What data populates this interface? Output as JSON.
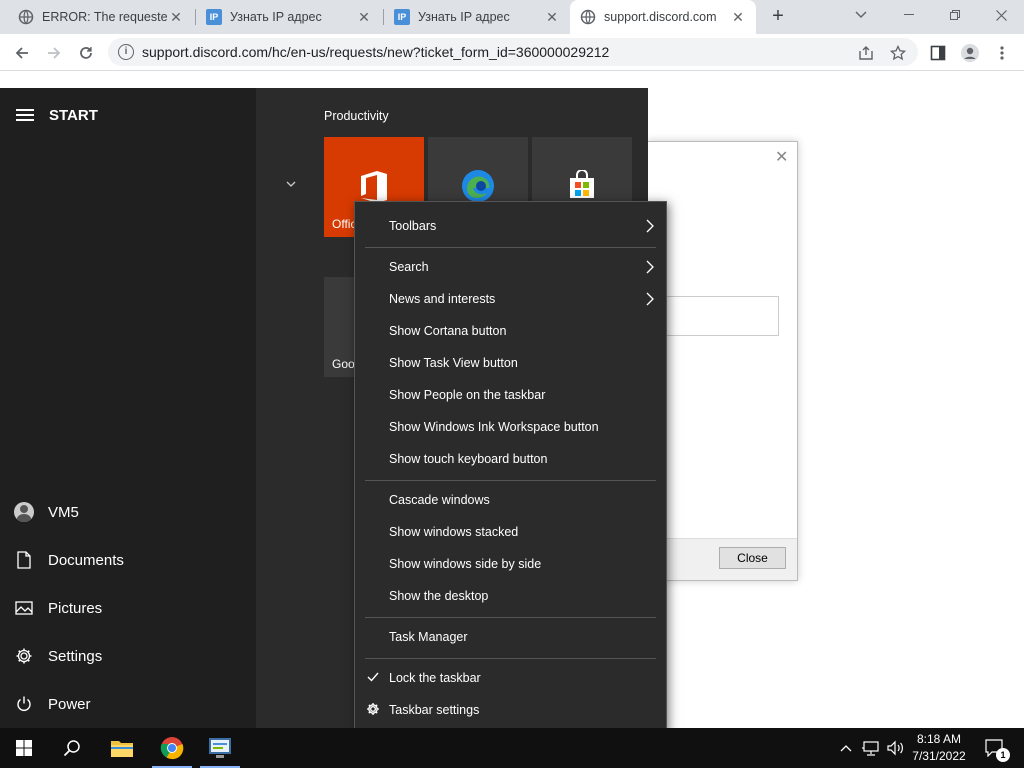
{
  "browser": {
    "tabs": [
      {
        "title": "ERROR: The requested URL could not be retrieved",
        "icon": "globe-icon"
      },
      {
        "title": "Узнать IP адрес",
        "icon": "ip-icon"
      },
      {
        "title": "Узнать IP адрес",
        "icon": "ip-icon"
      },
      {
        "title": "support.discord.com",
        "icon": "globe-icon"
      }
    ],
    "active_tab": 3,
    "url": "support.discord.com/hc/en-us/requests/new?ticket_form_id=360000029212",
    "ip_icon_text": "IP",
    "ip_icon_color": "#4a90d9"
  },
  "dialog": {
    "close_button": "Close"
  },
  "start_menu": {
    "title": "START",
    "user": "VM5",
    "items": [
      "Documents",
      "Pictures",
      "Settings",
      "Power"
    ],
    "group_title": "Productivity",
    "tiles": [
      {
        "label": "Office",
        "color": "#d83b01"
      },
      {
        "label": "",
        "color": "#3a3a3a"
      },
      {
        "label": "",
        "color": "#3a3a3a"
      },
      {
        "label": "Goo",
        "color": "#3a3a3a"
      }
    ]
  },
  "context_menu": {
    "items": [
      {
        "label": "Toolbars",
        "submenu": true
      },
      {
        "label": "Search",
        "submenu": true
      },
      {
        "label": "News and interests",
        "submenu": true
      },
      {
        "label": "Show Cortana button"
      },
      {
        "label": "Show Task View button"
      },
      {
        "label": "Show People on the taskbar"
      },
      {
        "label": "Show Windows Ink Workspace button"
      },
      {
        "label": "Show touch keyboard button"
      },
      {
        "label": "Cascade windows"
      },
      {
        "label": "Show windows stacked"
      },
      {
        "label": "Show windows side by side"
      },
      {
        "label": "Show the desktop"
      },
      {
        "label": "Task Manager"
      },
      {
        "label": "Lock the taskbar",
        "checked": true
      },
      {
        "label": "Taskbar settings",
        "icon": "gear-icon"
      }
    ]
  },
  "taskbar": {
    "time": "8:18 AM",
    "date": "7/31/2022",
    "notification_count": "1"
  }
}
